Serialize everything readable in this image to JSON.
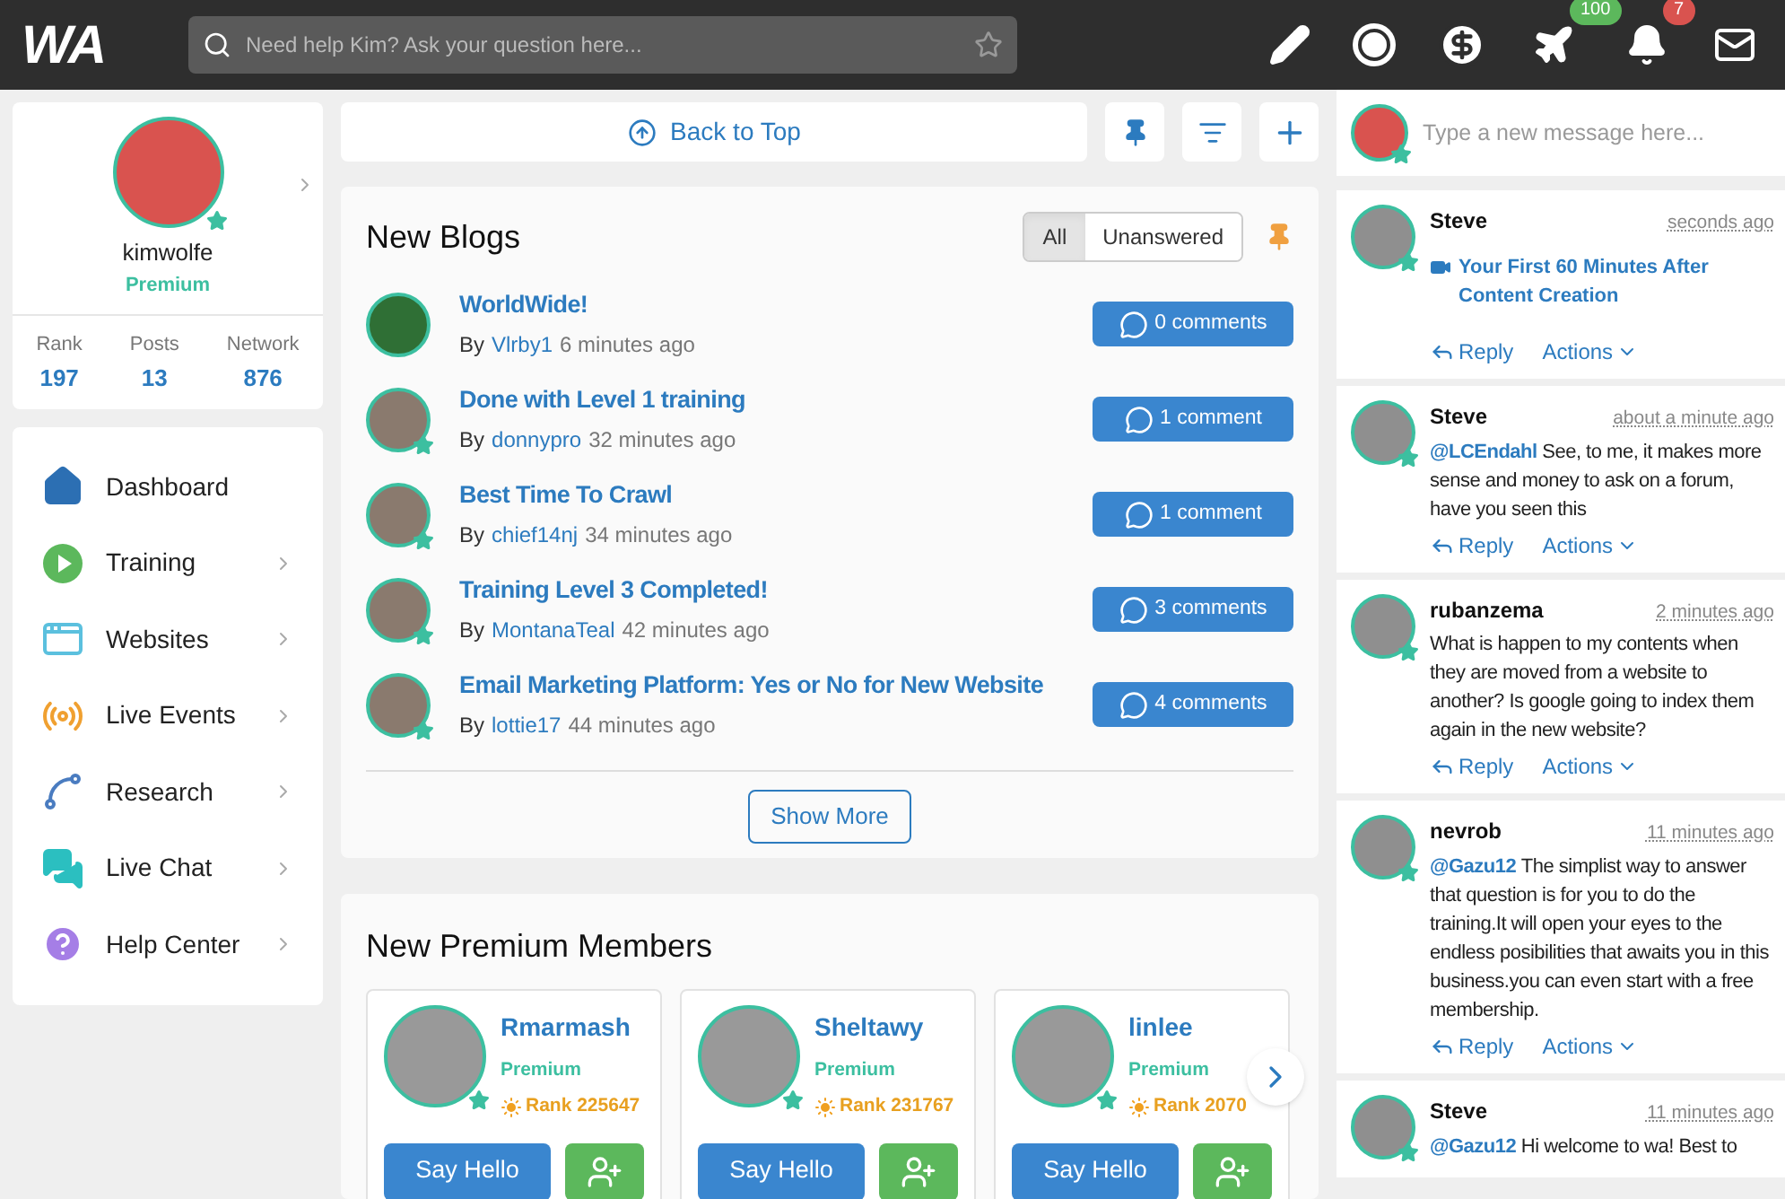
{
  "header": {
    "logo": "WA",
    "search": {
      "placeholder": "Need help Kim? Ask your question here..."
    },
    "badges": [
      {
        "kind": "plane",
        "count": "100"
      },
      {
        "kind": "bell",
        "count": "7"
      }
    ]
  },
  "profile": {
    "username": "kimwolfe",
    "membership": "Premium",
    "stats": [
      {
        "label": "Rank",
        "value": "197"
      },
      {
        "label": "Posts",
        "value": "13"
      },
      {
        "label": "Network",
        "value": "876"
      }
    ]
  },
  "nav": [
    {
      "kind": "dashboard",
      "label": "Dashboard",
      "has_arrow": false
    },
    {
      "kind": "training",
      "label": "Training",
      "has_arrow": true
    },
    {
      "kind": "websites",
      "label": "Websites",
      "has_arrow": true
    },
    {
      "kind": "live-events",
      "label": "Live Events",
      "has_arrow": true
    },
    {
      "kind": "research",
      "label": "Research",
      "has_arrow": true
    },
    {
      "kind": "live-chat",
      "label": "Live Chat",
      "has_arrow": true
    },
    {
      "kind": "help",
      "label": "Help Center",
      "has_arrow": true
    }
  ],
  "toolbar": {
    "back_to_top": "Back to Top"
  },
  "blogs": {
    "title": "New Blogs",
    "filters": [
      {
        "label": "All",
        "selected": true
      },
      {
        "label": "Unanswered",
        "selected": false
      }
    ],
    "items": [
      {
        "title": "WorldWide!",
        "by": "By",
        "author": "Vlrby1",
        "time": "6 minutes ago",
        "comments": "0 comments",
        "premium": false
      },
      {
        "title": "Done with Level 1 training",
        "by": "By",
        "author": "donnypro",
        "time": "32 minutes ago",
        "comments": "1 comment",
        "premium": true
      },
      {
        "title": "Best Time To Crawl",
        "by": "By",
        "author": "chief14nj",
        "time": "34 minutes ago",
        "comments": "1 comment",
        "premium": true
      },
      {
        "title": "Training Level 3 Completed!",
        "by": "By",
        "author": "MontanaTeal",
        "time": "42 minutes ago",
        "comments": "3 comments",
        "premium": true
      },
      {
        "title": "Email Marketing Platform: Yes or No for New Website",
        "by": "By",
        "author": "lottie17",
        "time": "44 minutes ago",
        "comments": "4 comments",
        "premium": true
      }
    ],
    "show_more": "Show More"
  },
  "premium_members": {
    "title": "New Premium Members",
    "members": [
      {
        "name": "Rmarmash",
        "membership": "Premium",
        "rank": "Rank 225647",
        "button": "Say Hello"
      },
      {
        "name": "Sheltawy",
        "membership": "Premium",
        "rank": "Rank 231767",
        "button": "Say Hello"
      },
      {
        "name": "linlee",
        "membership": "Premium",
        "rank": "Rank 2070",
        "button": "Say Hello"
      }
    ]
  },
  "chat": {
    "placeholder": "Type a new message here...",
    "messages": [
      {
        "kind": "video",
        "user": "Steve",
        "time": "seconds ago",
        "link": "Your First 60 Minutes After Content Creation",
        "reply": "Reply",
        "actions": "Actions"
      },
      {
        "kind": "text",
        "user": "Steve",
        "time": "about a minute ago",
        "mention": "@LCEndahl",
        "text": "See, to me, it makes more sense and money to ask on a forum, have you seen this",
        "reply": "Reply",
        "actions": "Actions"
      },
      {
        "kind": "text",
        "user": "rubanzema",
        "time": "2 minutes ago",
        "text": "What is happen to my contents when they are moved from a website to another? Is google going to index them again in the new website?",
        "reply": "Reply",
        "actions": "Actions"
      },
      {
        "kind": "text",
        "user": "nevrob",
        "time": "11 minutes ago",
        "mention": "@Gazu12",
        "text": "The simplist way to answer that question is for you to do the training.It will open your eyes to the endless posibilities that awaits you in this business.you can even start with a free membership.",
        "reply": "Reply",
        "actions": "Actions"
      },
      {
        "kind": "text",
        "user": "Steve",
        "time": "11 minutes ago",
        "mention": "@Gazu12",
        "text": "Hi welcome to wa! Best to"
      }
    ]
  }
}
